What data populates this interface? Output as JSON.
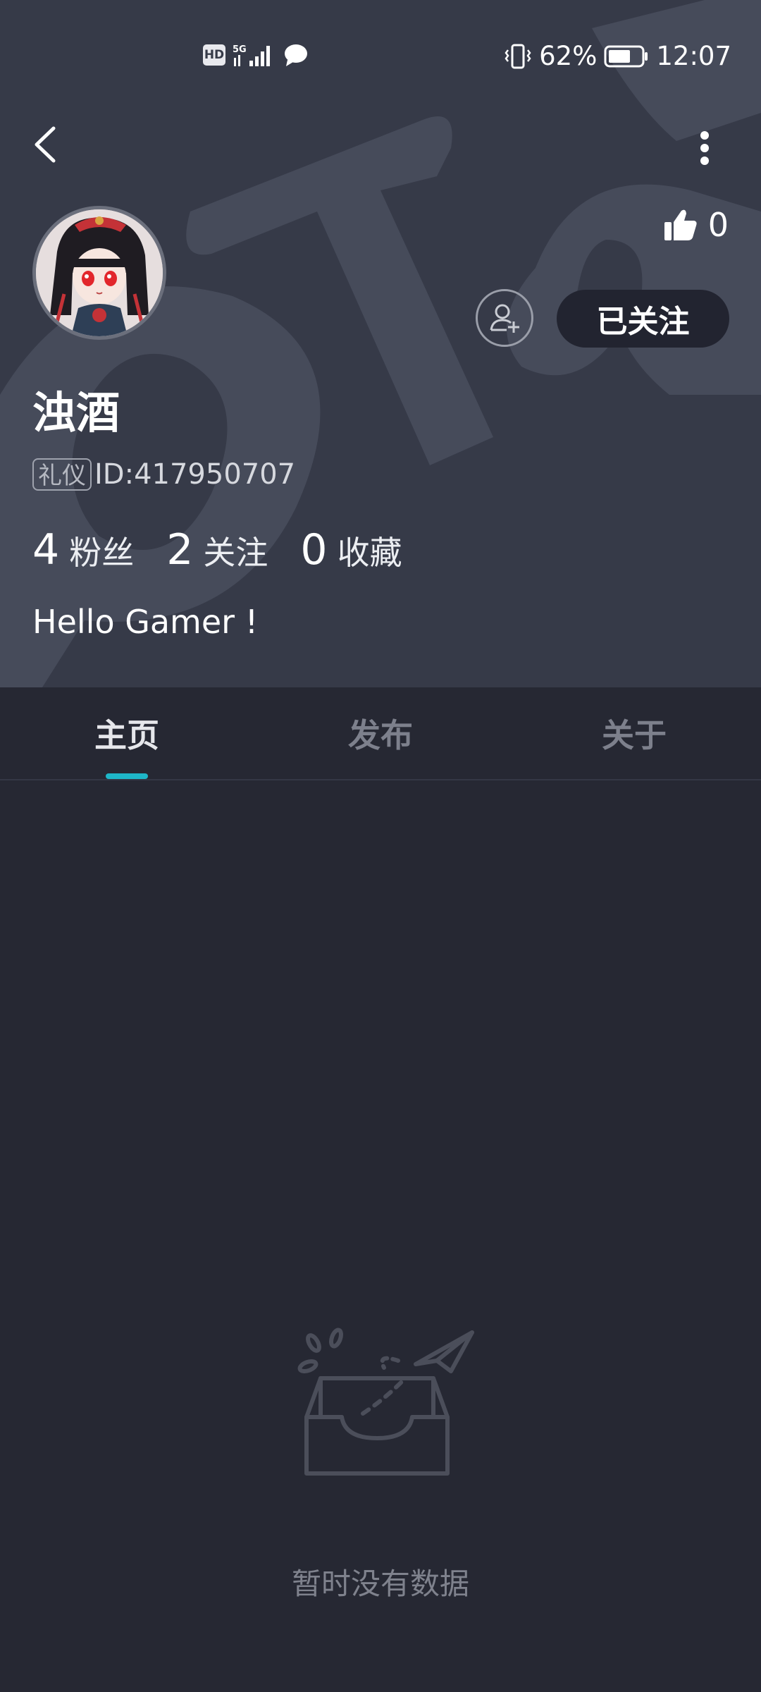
{
  "status_bar": {
    "left_badges": [
      "HD",
      "5G"
    ],
    "battery_percent": "62%",
    "time": "12:07",
    "icons": [
      "signal-icon",
      "message-bubble-icon",
      "vibrate-icon",
      "battery-icon"
    ]
  },
  "nav": {
    "back_icon": "chevron-left-icon",
    "more_icon": "more-vertical-icon"
  },
  "profile": {
    "username": "浊酒",
    "badge": "礼仪",
    "id": "ID:417950707",
    "like_count": "0",
    "follow_button": "已关注",
    "bio": "Hello Gamer !",
    "stats": [
      {
        "value": "4",
        "label": "粉丝"
      },
      {
        "value": "2",
        "label": "关注"
      },
      {
        "value": "0",
        "label": "收藏"
      }
    ]
  },
  "tabs": [
    {
      "label": "主页",
      "active": true
    },
    {
      "label": "发布",
      "active": false
    },
    {
      "label": "关于",
      "active": false
    }
  ],
  "empty_state": {
    "text": "暂时没有数据"
  },
  "colors": {
    "header_bg": "#363a48",
    "page_bg": "#262833",
    "accent": "#1eb6c8"
  }
}
